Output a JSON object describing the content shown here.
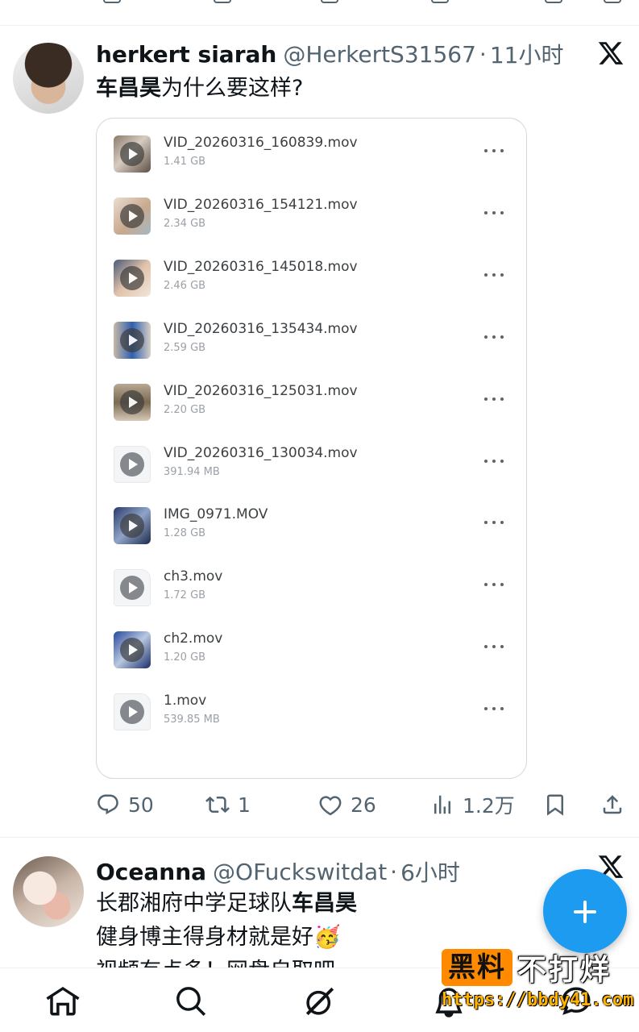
{
  "tweets": [
    {
      "name": "herkert siarah",
      "handle": "@HerkertS31567",
      "time": "11小时",
      "text_bold": "车昌昊",
      "text_rest": "为什么要这样?",
      "files": [
        {
          "name": "VID_20260316_160839.mov",
          "size": "1.41 GB",
          "thumb": "photo"
        },
        {
          "name": "VID_20260316_154121.mov",
          "size": "2.34 GB",
          "thumb": "photo"
        },
        {
          "name": "VID_20260316_145018.mov",
          "size": "2.46 GB",
          "thumb": "photo"
        },
        {
          "name": "VID_20260316_135434.mov",
          "size": "2.59 GB",
          "thumb": "photo"
        },
        {
          "name": "VID_20260316_125031.mov",
          "size": "2.20 GB",
          "thumb": "photo"
        },
        {
          "name": "VID_20260316_130034.mov",
          "size": "391.94 MB",
          "thumb": "plain"
        },
        {
          "name": "IMG_0971.MOV",
          "size": "1.28 GB",
          "thumb": "photo"
        },
        {
          "name": "ch3.mov",
          "size": "1.72 GB",
          "thumb": "plain"
        },
        {
          "name": "ch2.mov",
          "size": "1.20 GB",
          "thumb": "photo"
        },
        {
          "name": "1.mov",
          "size": "539.85 MB",
          "thumb": "plain"
        }
      ],
      "actions": {
        "replies": "50",
        "reposts": "1",
        "likes": "26",
        "views": "1.2万"
      }
    },
    {
      "name": "Oceanna",
      "handle": "@OFuckswitdat",
      "time": "6小时",
      "line1_rest": "长郡湘府中学足球队",
      "line1_bold": "车昌昊",
      "line2": "健身博主得身材就是好🥳",
      "line3": "视频有点多！网盘自取吧"
    }
  ],
  "watermark": {
    "brand_box": "黑料",
    "brand_rest": "不打烊",
    "url": "https://bbdy41.com"
  },
  "colors": {
    "accent": "#1d9bf0",
    "muted": "#536471",
    "border": "#cfd9de",
    "watermark_orange": "#ff8a00"
  },
  "icons": {
    "post_logo": "x-logo-icon",
    "nav": [
      "home-icon",
      "search-icon",
      "grok-icon",
      "notifications-icon",
      "messages-icon"
    ],
    "actions": [
      "reply-icon",
      "repost-icon",
      "like-icon",
      "views-icon",
      "bookmark-icon",
      "share-icon"
    ],
    "fab": "compose-icon"
  }
}
